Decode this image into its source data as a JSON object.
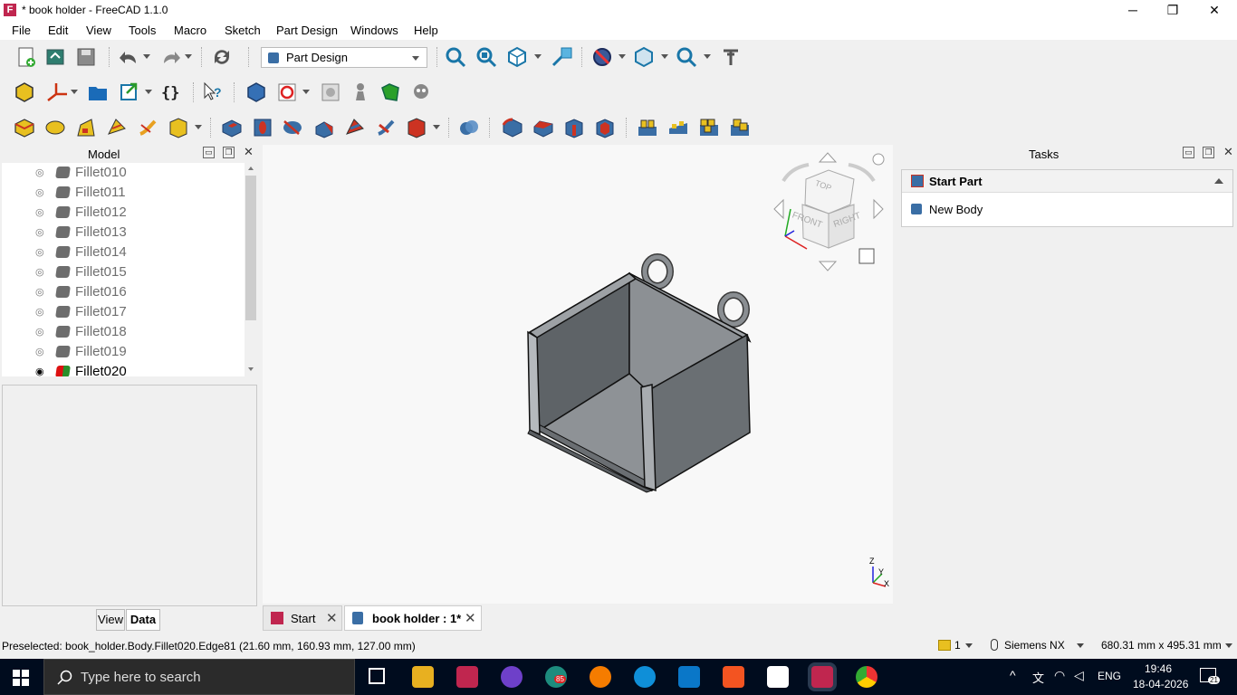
{
  "window": {
    "title": "* book holder - FreeCAD 1.1.0",
    "app_icon": "F",
    "controls": {
      "minimize": "─",
      "restore": "❐",
      "close": "✕"
    }
  },
  "menu": [
    "File",
    "Edit",
    "View",
    "Tools",
    "Macro",
    "Sketch",
    "Part Design",
    "Windows",
    "Help"
  ],
  "toolbar": {
    "workbench_selected": "Part Design"
  },
  "model_panel": {
    "title": "Model",
    "items": [
      "Fillet010",
      "Fillet011",
      "Fillet012",
      "Fillet013",
      "Fillet014",
      "Fillet015",
      "Fillet016",
      "Fillet017",
      "Fillet018",
      "Fillet019",
      "Fillet020"
    ],
    "tabs": {
      "view": "View",
      "data": "Data"
    }
  },
  "navcube": {
    "top": "TOP",
    "front": "FRONT",
    "right": "RIGHT"
  },
  "axis": {
    "z": "Z",
    "y": "Y",
    "x": "X"
  },
  "doc_tabs": [
    {
      "label": "Start"
    },
    {
      "label": "book holder : 1*"
    }
  ],
  "tasks": {
    "title": "Tasks",
    "section": "Start Part",
    "action": "New Body"
  },
  "status": {
    "preselected": "Preselected: book_holder.Body.Fillet020.Edge81 (21.60 mm, 160.93 mm, 127.00 mm)",
    "count": "1",
    "nav_style": "Siemens NX",
    "dimensions": "680.31 mm x 495.31 mm"
  },
  "taskbar": {
    "search_placeholder": "Type here to search",
    "language": "ENG",
    "time": "19:46",
    "date": "18-04-2026",
    "notification_count": "21",
    "badge_85": "85"
  },
  "colors": {
    "freecad_red": "#c0264f",
    "taskbar_bg": "#000c1e",
    "part_gray": "#7d8185"
  }
}
